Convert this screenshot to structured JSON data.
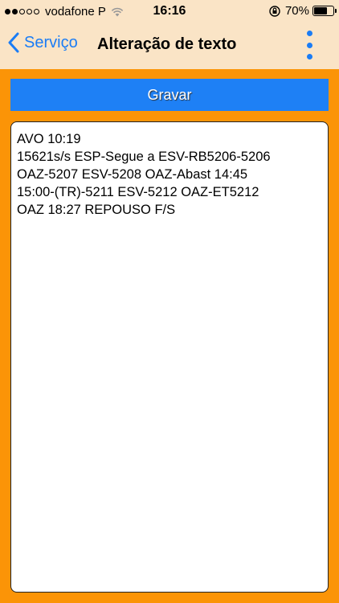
{
  "status_bar": {
    "carrier": "vodafone P",
    "time": "16:16",
    "battery_percent": "70%",
    "battery_level": 0.7
  },
  "nav": {
    "back_label": "Serviço",
    "title": "Alteração de texto"
  },
  "actions": {
    "save_label": "Gravar"
  },
  "editor": {
    "text": "AVO 10:19\n15621s/s ESP-Segue a ESV-RB5206-5206\nOAZ-5207 ESV-5208 OAZ-Abast 14:45\n15:00-(TR)-5211 ESV-5212 OAZ-ET5212\nOAZ 18:27 REPOUSO F/S"
  },
  "colors": {
    "accent": "#1a7cf5",
    "background": "#fb9407",
    "bar": "#fae4c6"
  }
}
